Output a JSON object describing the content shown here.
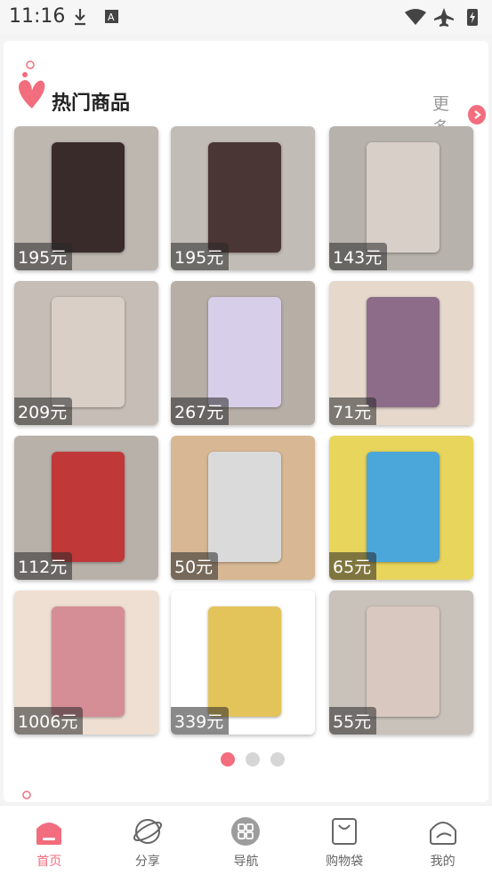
{
  "status": {
    "time": "11:16"
  },
  "section": {
    "title": "热门商品",
    "more": "更多"
  },
  "products": [
    {
      "price": "195元",
      "bg": "#bdb7b0",
      "photo": "#3a2b2b"
    },
    {
      "price": "195元",
      "bg": "#c2bcb6",
      "photo": "#4a3634"
    },
    {
      "price": "143元",
      "bg": "#b7b2ab",
      "photo": "#d7cfc8"
    },
    {
      "price": "209元",
      "bg": "#c6beb6",
      "photo": "#d9cfc7"
    },
    {
      "price": "267元",
      "bg": "#b7aea6",
      "photo": "#d7cfe9"
    },
    {
      "price": "71元",
      "bg": "#e6d9cc",
      "photo": "#8c6c88"
    },
    {
      "price": "112元",
      "bg": "#b8b1aa",
      "photo": "#c03838"
    },
    {
      "price": "50元",
      "bg": "#d8b894",
      "photo": "#dadada"
    },
    {
      "price": "65元",
      "bg": "#e8d55c",
      "photo": "#4ba7d9"
    },
    {
      "price": "1006元",
      "bg": "#eedfd2",
      "photo": "#d58d96"
    },
    {
      "price": "339元",
      "bg": "#ffffff",
      "photo": "#e3c45a"
    },
    {
      "price": "55元",
      "bg": "#c9c2bb",
      "photo": "#d8c8bf"
    }
  ],
  "pager": {
    "count": 3,
    "active": 0
  },
  "tabs": [
    {
      "label": "首页",
      "icon": "home-icon",
      "active": true
    },
    {
      "label": "分享",
      "icon": "planet-icon",
      "active": false
    },
    {
      "label": "导航",
      "icon": "grid-icon",
      "active": false
    },
    {
      "label": "购物袋",
      "icon": "shopping-bag-icon",
      "active": false
    },
    {
      "label": "我的",
      "icon": "profile-icon",
      "active": false
    }
  ],
  "colors": {
    "accent": "#f26d7d",
    "muted": "#9a9a9a"
  }
}
